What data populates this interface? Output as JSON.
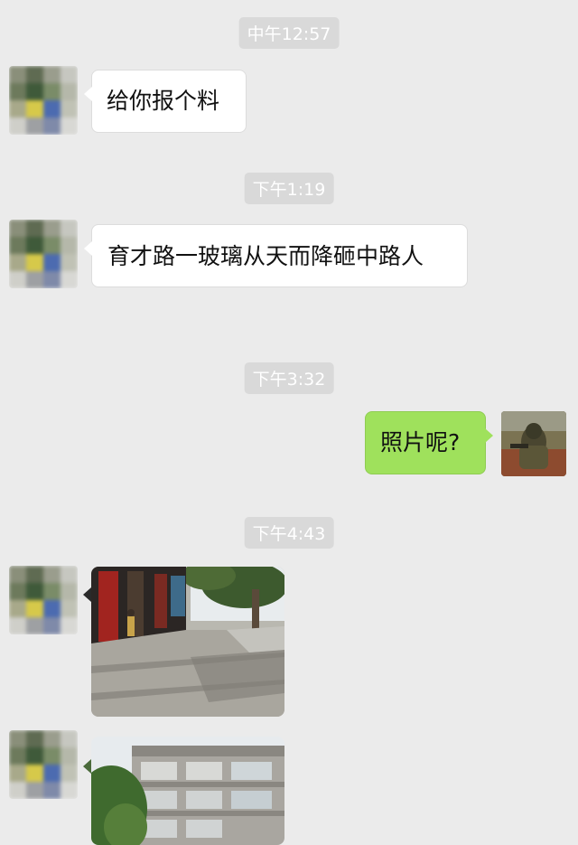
{
  "messages": [
    {
      "time": "中午12:57",
      "side": "left",
      "text": "给你报个料"
    },
    {
      "time": "下午1:19",
      "side": "left",
      "text": "育才路一玻璃从天而降砸中路人"
    },
    {
      "time": "下午3:32",
      "side": "right",
      "text": "照片呢?"
    },
    {
      "time": "下午4:43",
      "side": "left",
      "type": "image",
      "image_desc": "street-photo"
    },
    {
      "side": "left",
      "type": "image",
      "image_desc": "building-photo"
    }
  ],
  "colors": {
    "background": "#ebebeb",
    "time_badge": "#d9d9d9",
    "incoming_bubble": "#ffffff",
    "outgoing_bubble": "#9fe15c"
  }
}
